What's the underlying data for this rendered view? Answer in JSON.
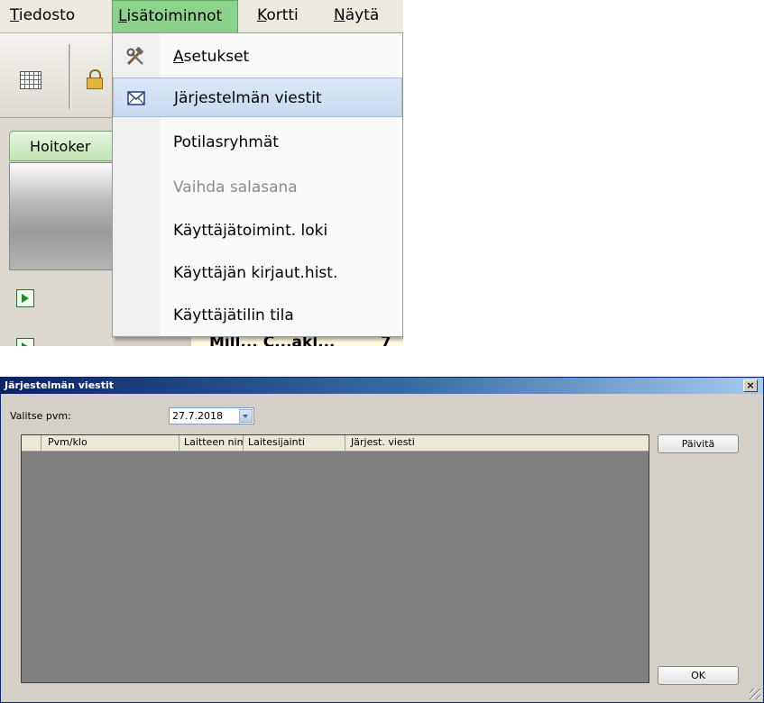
{
  "menubar": {
    "items": [
      {
        "underline": "T",
        "rest": "iedosto"
      },
      {
        "underline": "L",
        "rest": "isätoiminnot"
      },
      {
        "underline": "K",
        "rest": "ortti"
      },
      {
        "underline": "N",
        "rest": "äytä"
      }
    ]
  },
  "dropdown": {
    "items": [
      {
        "underline": "A",
        "rest": "setukset",
        "icon": "tools-icon",
        "state": "normal"
      },
      {
        "label": "Järjestelmän viestit",
        "icon": "envelope-icon",
        "state": "highlighted"
      },
      {
        "label": "Potilasryhmät",
        "state": "normal"
      },
      {
        "label": "Vaihda salasana",
        "state": "disabled"
      },
      {
        "label": "Käyttäjätoimint. loki",
        "state": "normal"
      },
      {
        "label": "Käyttäjän kirjaut.hist.",
        "state": "normal"
      },
      {
        "label": "Käyttäjätilin tila",
        "state": "normal"
      }
    ]
  },
  "leftpanel": {
    "tab_label": "Hoitoker",
    "peek_text": "Mill... C...akl...",
    "peek_text2": "7"
  },
  "toolbar": {
    "icons": [
      "grid-icon",
      "lock-icon"
    ]
  },
  "dialog": {
    "title": "Järjestelmän viestit",
    "close_glyph": "×",
    "date_label": "Valitse pvm:",
    "date_value": "27.7.2018",
    "columns": [
      "",
      "Pvm/klo",
      "Laitteen nimi",
      "Laitesijainti",
      "Järjest. viesti"
    ],
    "rows": [],
    "refresh_button": "Päivitä",
    "ok_button": "OK"
  },
  "colors": {
    "menu_highlight": "#8cd18c",
    "item_highlight": "#c6daf0",
    "titlebar": "#0a246a",
    "grid_background": "#808080"
  }
}
